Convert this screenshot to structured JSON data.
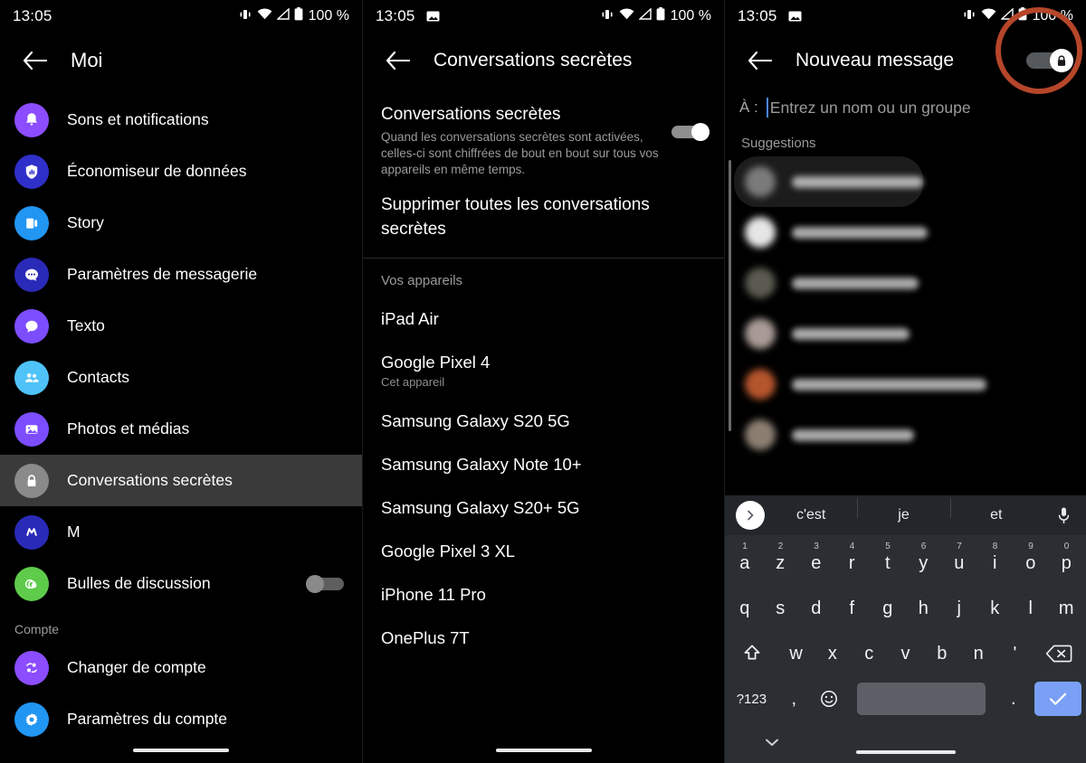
{
  "statusbar": {
    "time": "13:05",
    "battery": "100 %",
    "icons": [
      "vibrate-icon",
      "wifi-icon",
      "signal-icon",
      "battery-icon"
    ]
  },
  "panel1": {
    "title": "Moi",
    "back_icon": "back-arrow-icon",
    "items": [
      {
        "label": "Sons et notifications",
        "icon": "bell-icon",
        "color": "#8b4dff"
      },
      {
        "label": "Économiseur de données",
        "icon": "shield-data-icon",
        "color": "#2f2fc9"
      },
      {
        "label": "Story",
        "icon": "story-icon",
        "color": "#2196f3"
      },
      {
        "label": "Paramètres de messagerie",
        "icon": "chat-bubble-icon",
        "color": "#2a2ab8"
      },
      {
        "label": "Texto",
        "icon": "sms-bubble-icon",
        "color": "#7c4dff"
      },
      {
        "label": "Contacts",
        "icon": "contacts-icon",
        "color": "#4fc3f7"
      },
      {
        "label": "Photos et médias",
        "icon": "photo-icon",
        "color": "#7c4dff"
      },
      {
        "label": "Conversations secrètes",
        "icon": "lock-icon",
        "color": "#8a8a8a",
        "selected": true
      },
      {
        "label": "M",
        "icon": "m-assistant-icon",
        "color": "#2a2ab8"
      },
      {
        "label": "Bulles de discussion",
        "icon": "bubbles-icon",
        "color": "#5ecb4b",
        "toggle": "off"
      }
    ],
    "section_compte": "Compte",
    "account_items": [
      {
        "label": "Changer de compte",
        "icon": "switch-account-icon",
        "color": "#8b4dff"
      },
      {
        "label": "Paramètres du compte",
        "icon": "gear-icon",
        "color": "#2196f3"
      }
    ]
  },
  "panel2": {
    "title": "Conversations secrètes",
    "back_icon": "back-arrow-icon",
    "setting_title": "Conversations secrètes",
    "setting_desc": "Quand les conversations secrètes sont activées, celles-ci sont chiffrées de bout en bout sur tous vos appareils en même temps.",
    "setting_toggle": "on",
    "delete_all": "Supprimer toutes les conversations secrètes",
    "devices_header": "Vos appareils",
    "devices": [
      {
        "name": "iPad Air",
        "sub": ""
      },
      {
        "name": "Google Pixel 4",
        "sub": "Cet appareil"
      },
      {
        "name": "Samsung Galaxy S20 5G",
        "sub": ""
      },
      {
        "name": "Samsung Galaxy Note 10+",
        "sub": ""
      },
      {
        "name": "Samsung Galaxy S20+ 5G",
        "sub": ""
      },
      {
        "name": "Google Pixel 3 XL",
        "sub": ""
      },
      {
        "name": "iPhone 11 Pro",
        "sub": ""
      },
      {
        "name": "OnePlus 7T",
        "sub": ""
      }
    ]
  },
  "panel3": {
    "title": "Nouveau message",
    "back_icon": "back-arrow-icon",
    "secret_toggle_icon": "lock-icon",
    "secret_toggle_state": "on",
    "annotation_color": "#b5462a",
    "to_label": "À :",
    "to_placeholder": "Entrez un nom ou un groupe",
    "to_value": "",
    "suggestions_header": "Suggestions",
    "suggestion_rows": [
      {
        "name_width": 200,
        "avatar_color": "#7b7b7b",
        "highlight": true
      },
      {
        "name_width": 150,
        "avatar_color": "#e6e6e6"
      },
      {
        "name_width": 140,
        "avatar_color": "#5a5a50"
      },
      {
        "name_width": 130,
        "avatar_color": "#a89a95"
      },
      {
        "name_width": 215,
        "avatar_color": "#b4552c"
      },
      {
        "name_width": 135,
        "avatar_color": "#8c7f72"
      }
    ],
    "keyboard": {
      "expand_icon": "chevron-right-icon",
      "mic_icon": "microphone-icon",
      "suggestions": [
        "c'est",
        "je",
        "et"
      ],
      "row1": [
        {
          "key": "a",
          "num": "1"
        },
        {
          "key": "z",
          "num": "2"
        },
        {
          "key": "e",
          "num": "3"
        },
        {
          "key": "r",
          "num": "4"
        },
        {
          "key": "t",
          "num": "5"
        },
        {
          "key": "y",
          "num": "6"
        },
        {
          "key": "u",
          "num": "7"
        },
        {
          "key": "i",
          "num": "8"
        },
        {
          "key": "o",
          "num": "9"
        },
        {
          "key": "p",
          "num": "0"
        }
      ],
      "row2": [
        "q",
        "s",
        "d",
        "f",
        "g",
        "h",
        "j",
        "k",
        "l",
        "m"
      ],
      "row3": [
        "w",
        "x",
        "c",
        "v",
        "b",
        "n",
        "'"
      ],
      "shift_icon": "shift-icon",
      "backspace_icon": "backspace-icon",
      "symbols_key": "?123",
      "comma_key": ",",
      "emoji_icon": "emoji-icon",
      "period_key": ".",
      "enter_icon": "check-icon",
      "hide_icon": "chevron-down-icon"
    }
  }
}
